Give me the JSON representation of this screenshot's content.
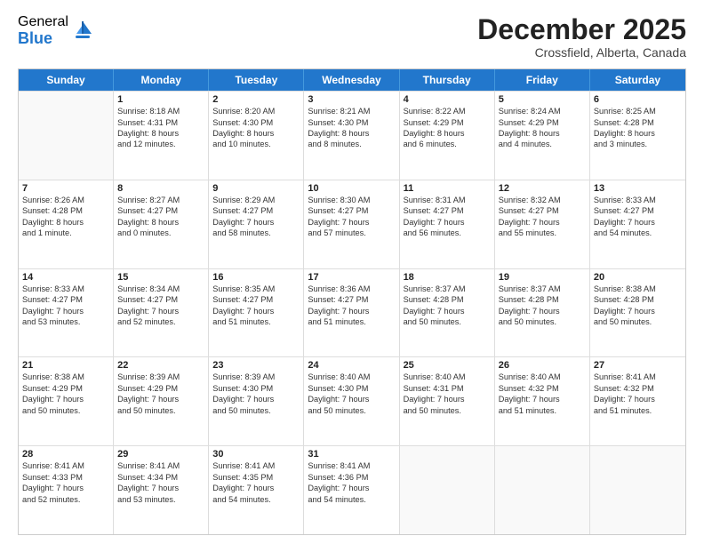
{
  "logo": {
    "general": "General",
    "blue": "Blue"
  },
  "title": "December 2025",
  "location": "Crossfield, Alberta, Canada",
  "days": [
    "Sunday",
    "Monday",
    "Tuesday",
    "Wednesday",
    "Thursday",
    "Friday",
    "Saturday"
  ],
  "weeks": [
    [
      {
        "day": "",
        "empty": true
      },
      {
        "day": "1",
        "lines": [
          "Sunrise: 8:18 AM",
          "Sunset: 4:31 PM",
          "Daylight: 8 hours",
          "and 12 minutes."
        ]
      },
      {
        "day": "2",
        "lines": [
          "Sunrise: 8:20 AM",
          "Sunset: 4:30 PM",
          "Daylight: 8 hours",
          "and 10 minutes."
        ]
      },
      {
        "day": "3",
        "lines": [
          "Sunrise: 8:21 AM",
          "Sunset: 4:30 PM",
          "Daylight: 8 hours",
          "and 8 minutes."
        ]
      },
      {
        "day": "4",
        "lines": [
          "Sunrise: 8:22 AM",
          "Sunset: 4:29 PM",
          "Daylight: 8 hours",
          "and 6 minutes."
        ]
      },
      {
        "day": "5",
        "lines": [
          "Sunrise: 8:24 AM",
          "Sunset: 4:29 PM",
          "Daylight: 8 hours",
          "and 4 minutes."
        ]
      },
      {
        "day": "6",
        "lines": [
          "Sunrise: 8:25 AM",
          "Sunset: 4:28 PM",
          "Daylight: 8 hours",
          "and 3 minutes."
        ]
      }
    ],
    [
      {
        "day": "7",
        "lines": [
          "Sunrise: 8:26 AM",
          "Sunset: 4:28 PM",
          "Daylight: 8 hours",
          "and 1 minute."
        ]
      },
      {
        "day": "8",
        "lines": [
          "Sunrise: 8:27 AM",
          "Sunset: 4:27 PM",
          "Daylight: 8 hours",
          "and 0 minutes."
        ]
      },
      {
        "day": "9",
        "lines": [
          "Sunrise: 8:29 AM",
          "Sunset: 4:27 PM",
          "Daylight: 7 hours",
          "and 58 minutes."
        ]
      },
      {
        "day": "10",
        "lines": [
          "Sunrise: 8:30 AM",
          "Sunset: 4:27 PM",
          "Daylight: 7 hours",
          "and 57 minutes."
        ]
      },
      {
        "day": "11",
        "lines": [
          "Sunrise: 8:31 AM",
          "Sunset: 4:27 PM",
          "Daylight: 7 hours",
          "and 56 minutes."
        ]
      },
      {
        "day": "12",
        "lines": [
          "Sunrise: 8:32 AM",
          "Sunset: 4:27 PM",
          "Daylight: 7 hours",
          "and 55 minutes."
        ]
      },
      {
        "day": "13",
        "lines": [
          "Sunrise: 8:33 AM",
          "Sunset: 4:27 PM",
          "Daylight: 7 hours",
          "and 54 minutes."
        ]
      }
    ],
    [
      {
        "day": "14",
        "lines": [
          "Sunrise: 8:33 AM",
          "Sunset: 4:27 PM",
          "Daylight: 7 hours",
          "and 53 minutes."
        ]
      },
      {
        "day": "15",
        "lines": [
          "Sunrise: 8:34 AM",
          "Sunset: 4:27 PM",
          "Daylight: 7 hours",
          "and 52 minutes."
        ]
      },
      {
        "day": "16",
        "lines": [
          "Sunrise: 8:35 AM",
          "Sunset: 4:27 PM",
          "Daylight: 7 hours",
          "and 51 minutes."
        ]
      },
      {
        "day": "17",
        "lines": [
          "Sunrise: 8:36 AM",
          "Sunset: 4:27 PM",
          "Daylight: 7 hours",
          "and 51 minutes."
        ]
      },
      {
        "day": "18",
        "lines": [
          "Sunrise: 8:37 AM",
          "Sunset: 4:28 PM",
          "Daylight: 7 hours",
          "and 50 minutes."
        ]
      },
      {
        "day": "19",
        "lines": [
          "Sunrise: 8:37 AM",
          "Sunset: 4:28 PM",
          "Daylight: 7 hours",
          "and 50 minutes."
        ]
      },
      {
        "day": "20",
        "lines": [
          "Sunrise: 8:38 AM",
          "Sunset: 4:28 PM",
          "Daylight: 7 hours",
          "and 50 minutes."
        ]
      }
    ],
    [
      {
        "day": "21",
        "lines": [
          "Sunrise: 8:38 AM",
          "Sunset: 4:29 PM",
          "Daylight: 7 hours",
          "and 50 minutes."
        ]
      },
      {
        "day": "22",
        "lines": [
          "Sunrise: 8:39 AM",
          "Sunset: 4:29 PM",
          "Daylight: 7 hours",
          "and 50 minutes."
        ]
      },
      {
        "day": "23",
        "lines": [
          "Sunrise: 8:39 AM",
          "Sunset: 4:30 PM",
          "Daylight: 7 hours",
          "and 50 minutes."
        ]
      },
      {
        "day": "24",
        "lines": [
          "Sunrise: 8:40 AM",
          "Sunset: 4:30 PM",
          "Daylight: 7 hours",
          "and 50 minutes."
        ]
      },
      {
        "day": "25",
        "lines": [
          "Sunrise: 8:40 AM",
          "Sunset: 4:31 PM",
          "Daylight: 7 hours",
          "and 50 minutes."
        ]
      },
      {
        "day": "26",
        "lines": [
          "Sunrise: 8:40 AM",
          "Sunset: 4:32 PM",
          "Daylight: 7 hours",
          "and 51 minutes."
        ]
      },
      {
        "day": "27",
        "lines": [
          "Sunrise: 8:41 AM",
          "Sunset: 4:32 PM",
          "Daylight: 7 hours",
          "and 51 minutes."
        ]
      }
    ],
    [
      {
        "day": "28",
        "lines": [
          "Sunrise: 8:41 AM",
          "Sunset: 4:33 PM",
          "Daylight: 7 hours",
          "and 52 minutes."
        ]
      },
      {
        "day": "29",
        "lines": [
          "Sunrise: 8:41 AM",
          "Sunset: 4:34 PM",
          "Daylight: 7 hours",
          "and 53 minutes."
        ]
      },
      {
        "day": "30",
        "lines": [
          "Sunrise: 8:41 AM",
          "Sunset: 4:35 PM",
          "Daylight: 7 hours",
          "and 54 minutes."
        ]
      },
      {
        "day": "31",
        "lines": [
          "Sunrise: 8:41 AM",
          "Sunset: 4:36 PM",
          "Daylight: 7 hours",
          "and 54 minutes."
        ]
      },
      {
        "day": "",
        "empty": true
      },
      {
        "day": "",
        "empty": true
      },
      {
        "day": "",
        "empty": true
      }
    ]
  ]
}
